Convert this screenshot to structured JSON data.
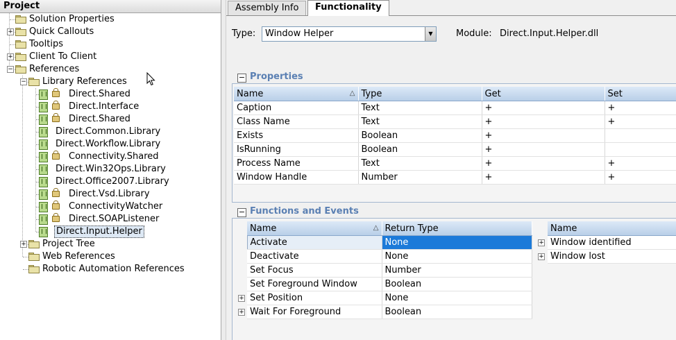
{
  "project": {
    "title": "Project",
    "items": [
      {
        "label": "Solution Properties",
        "level": 1,
        "icon": "folder-icon",
        "toggle": ""
      },
      {
        "label": "Quick Callouts",
        "level": 1,
        "icon": "folder-icon",
        "toggle": "+"
      },
      {
        "label": "Tooltips",
        "level": 1,
        "icon": "folder-icon",
        "toggle": ""
      },
      {
        "label": "Client To Client",
        "level": 1,
        "icon": "folder-icon",
        "toggle": "+"
      },
      {
        "label": "References",
        "level": 1,
        "icon": "folder-icon",
        "toggle": "-"
      },
      {
        "label": "Library References",
        "level": 2,
        "icon": "folder-icon",
        "toggle": "-"
      },
      {
        "label": "Direct.Shared",
        "level": 3,
        "icon": "reference-icon",
        "locked": true
      },
      {
        "label": "Direct.Interface",
        "level": 3,
        "icon": "reference-icon",
        "locked": true
      },
      {
        "label": "Direct.Shared",
        "level": 3,
        "icon": "reference-icon",
        "locked": true
      },
      {
        "label": "Direct.Common.Library",
        "level": 3,
        "icon": "reference-icon",
        "locked": false
      },
      {
        "label": "Direct.Workflow.Library",
        "level": 3,
        "icon": "reference-icon",
        "locked": false
      },
      {
        "label": "Connectivity.Shared",
        "level": 3,
        "icon": "reference-icon",
        "locked": true
      },
      {
        "label": "Direct.Win32Ops.Library",
        "level": 3,
        "icon": "reference-icon",
        "locked": false
      },
      {
        "label": "Direct.Office2007.Library",
        "level": 3,
        "icon": "reference-icon",
        "locked": false
      },
      {
        "label": "Direct.Vsd.Library",
        "level": 3,
        "icon": "reference-icon",
        "locked": true
      },
      {
        "label": "ConnectivityWatcher",
        "level": 3,
        "icon": "reference-icon",
        "locked": true
      },
      {
        "label": "Direct.SOAPListener",
        "level": 3,
        "icon": "reference-icon",
        "locked": true
      },
      {
        "label": "Direct.Input.Helper",
        "level": 3,
        "icon": "reference-icon",
        "locked": false,
        "selected": true
      },
      {
        "label": "Project Tree",
        "level": 2,
        "icon": "folder-icon",
        "toggle": "+"
      },
      {
        "label": "Web References",
        "level": 2,
        "icon": "folder-icon",
        "toggle": ""
      },
      {
        "label": "Robotic Automation References",
        "level": 2,
        "icon": "folder-icon",
        "toggle": ""
      }
    ]
  },
  "tabs": [
    {
      "label": "Assembly Info",
      "active": false
    },
    {
      "label": "Functionality",
      "active": true
    }
  ],
  "type_field": {
    "label": "Type:",
    "value": "Window Helper"
  },
  "module": {
    "label": "Module:",
    "value": "Direct.Input.Helper.dll"
  },
  "properties": {
    "title": "Properties",
    "columns": [
      "Name",
      "Type",
      "Get",
      "Set"
    ],
    "rows": [
      [
        "Caption",
        "Text",
        "+",
        "+"
      ],
      [
        "Class Name",
        "Text",
        "+",
        "+"
      ],
      [
        "Exists",
        "Boolean",
        "+",
        ""
      ],
      [
        "IsRunning",
        "Boolean",
        "+",
        ""
      ],
      [
        "Process Name",
        "Text",
        "+",
        "+"
      ],
      [
        "Window Handle",
        "Number",
        "+",
        "+"
      ]
    ]
  },
  "functions": {
    "title": "Functions and Events",
    "columns": [
      "Name",
      "Return Type"
    ],
    "rows": [
      {
        "name": "Activate",
        "return_type": "None",
        "expandable": false,
        "selected": true
      },
      {
        "name": "Deactivate",
        "return_type": "None",
        "expandable": false
      },
      {
        "name": "Set Focus",
        "return_type": "Number",
        "expandable": false
      },
      {
        "name": "Set Foreground Window",
        "return_type": "Boolean",
        "expandable": false
      },
      {
        "name": "Set Position",
        "return_type": "None",
        "expandable": true
      },
      {
        "name": "Wait For Foreground",
        "return_type": "Boolean",
        "expandable": true
      }
    ]
  },
  "events": {
    "columns": [
      "Name"
    ],
    "rows": [
      {
        "name": "Window identified",
        "expandable": true
      },
      {
        "name": "Window lost",
        "expandable": true
      }
    ]
  }
}
